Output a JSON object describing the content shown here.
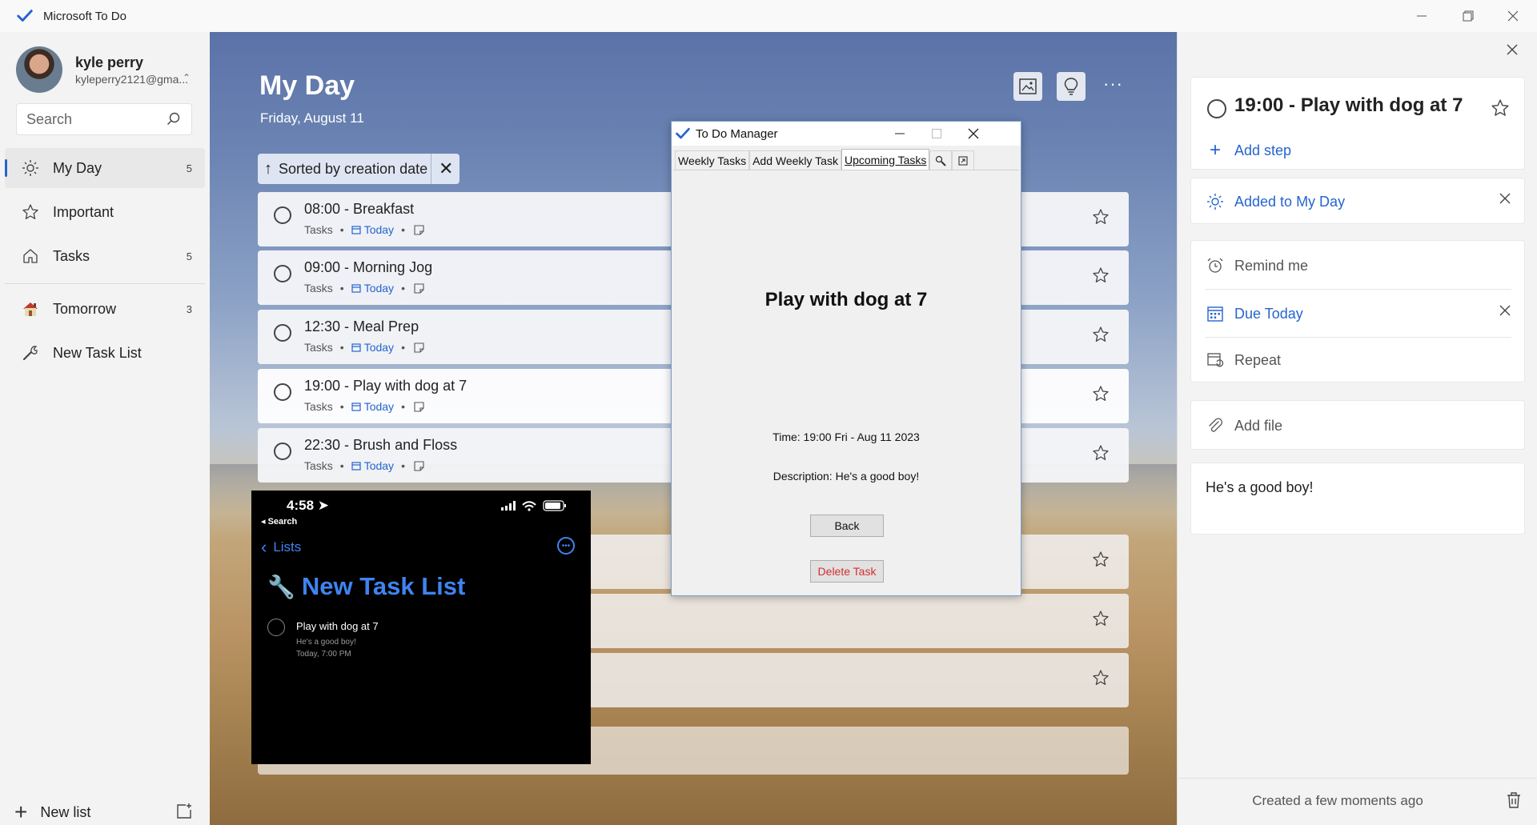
{
  "window": {
    "title": "Microsoft To Do"
  },
  "profile": {
    "name": "kyle perry",
    "email": "kyleperry2121@gma..."
  },
  "search": {
    "placeholder": "Search"
  },
  "sidebar": {
    "items": [
      {
        "label": "My Day",
        "count": "5",
        "icon": "sun-icon"
      },
      {
        "label": "Important",
        "count": "",
        "icon": "star-icon"
      },
      {
        "label": "Tasks",
        "count": "5",
        "icon": "home-icon"
      },
      {
        "label": "Tomorrow",
        "count": "3",
        "icon": "house-emoji-icon"
      },
      {
        "label": "New Task List",
        "count": "",
        "icon": "wrench-icon"
      }
    ],
    "new_list_label": "New list"
  },
  "main": {
    "title": "My Day",
    "date": "Friday, August 11",
    "sort_label": "Sorted by creation date",
    "tasks": [
      {
        "title": "08:00 - Breakfast",
        "list": "Tasks",
        "due": "Today"
      },
      {
        "title": "09:00 - Morning Jog",
        "list": "Tasks",
        "due": "Today"
      },
      {
        "title": "12:30 - Meal Prep",
        "list": "Tasks",
        "due": "Today"
      },
      {
        "title": "19:00 - Play with dog at 7",
        "list": "Tasks",
        "due": "Today"
      },
      {
        "title": "22:30 - Brush and Floss",
        "list": "Tasks",
        "due": "Today"
      }
    ]
  },
  "phone": {
    "time": "4:58",
    "back_search": "◂ Search",
    "back_label": "Lists",
    "list_title": "New Task List",
    "task_title": "Play with dog at 7",
    "task_desc": "He's a good boy!",
    "task_when": "Today, 7:00 PM"
  },
  "dialog": {
    "title": "To Do Manager",
    "tabs": [
      "Weekly Tasks",
      "Add Weekly Task",
      "Upcoming Tasks"
    ],
    "heading": "Play with dog at 7",
    "time": "Time: 19:00 Fri - Aug 11 2023",
    "description": "Description: He's a good boy!",
    "back_label": "Back",
    "delete_label": "Delete Task"
  },
  "detail": {
    "title": "19:00 - Play with dog at 7",
    "add_step": "Add step",
    "added_to_my_day": "Added to My Day",
    "remind_me": "Remind me",
    "due": "Due Today",
    "repeat": "Repeat",
    "add_file": "Add file",
    "note": "He's a good boy!",
    "created": "Created a few moments ago"
  },
  "colors": {
    "accent": "#2564cf",
    "delete": "#d32f2f"
  }
}
